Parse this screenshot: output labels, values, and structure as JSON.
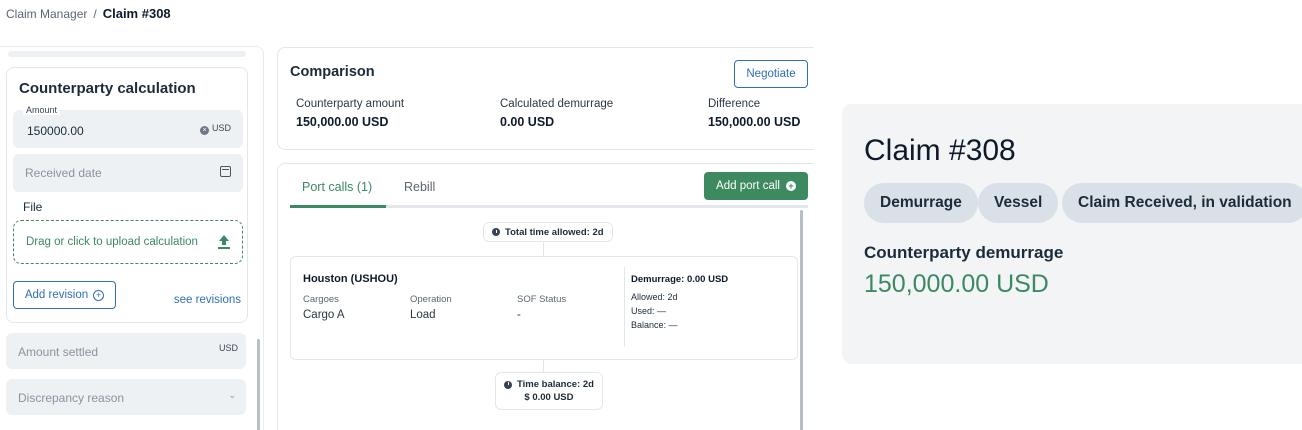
{
  "breadcrumb": {
    "parent": "Claim Manager",
    "separator": "/",
    "current": "Claim #308"
  },
  "counterparty": {
    "title": "Counterparty calculation",
    "amount_label": "Amount",
    "amount_value": "150000.00",
    "amount_currency": "USD",
    "received_date_placeholder": "Received date",
    "file_label": "File",
    "upload_text": "Drag or click to upload calculation",
    "add_revision": "Add revision",
    "see_revisions": "see revisions",
    "amount_settled_placeholder": "Amount settled",
    "amount_settled_currency": "USD",
    "discrepancy_placeholder": "Discrepancy reason"
  },
  "comparison": {
    "title": "Comparison",
    "negotiate": "Negotiate",
    "items": [
      {
        "label": "Counterparty amount",
        "value": "150,000.00 USD"
      },
      {
        "label": "Calculated demurrage",
        "value": "0.00 USD"
      },
      {
        "label": "Difference",
        "value": "150,000.00 USD"
      }
    ]
  },
  "port_calls": {
    "tabs": [
      {
        "label": "Port calls (1)",
        "active": true
      },
      {
        "label": "Rebill",
        "active": false
      }
    ],
    "add_button": "Add port call",
    "total_time_allowed": "Total time allowed: 2d",
    "port": {
      "name": "Houston (USHOU)",
      "headers": [
        "Cargoes",
        "Operation",
        "SOF Status"
      ],
      "values": [
        "Cargo A",
        "Load",
        "-"
      ],
      "demurrage": "Demurrage: 0.00 USD",
      "allowed": "Allowed: 2d",
      "used": "Used: —",
      "balance": "Balance: —"
    },
    "time_balance": "Time balance: 2d",
    "time_balance_amount": "$  0.00 USD"
  },
  "claim": {
    "title": "Claim #308",
    "chips": [
      "Demurrage",
      "Vessel",
      "Claim Received, in validation"
    ],
    "counterparty_label": "Counterparty demurrage",
    "counterparty_value": "150,000.00 USD"
  },
  "colors": {
    "accent_green": "#3b8a62",
    "link_blue": "#2f6fb3",
    "chip_bg": "#d9e0e7"
  }
}
